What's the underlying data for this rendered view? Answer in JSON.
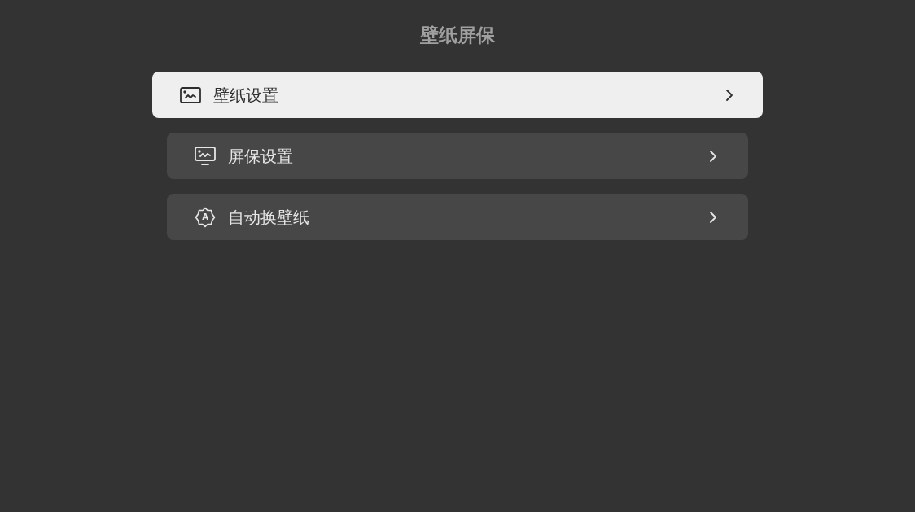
{
  "title": "壁纸屏保",
  "items": [
    {
      "label": "壁纸设置",
      "kind": "wallpaper",
      "selected": true
    },
    {
      "label": "屏保设置",
      "kind": "screensaver",
      "selected": false
    },
    {
      "label": "自动换壁纸",
      "kind": "auto",
      "selected": false,
      "icon_letter": "A"
    }
  ]
}
